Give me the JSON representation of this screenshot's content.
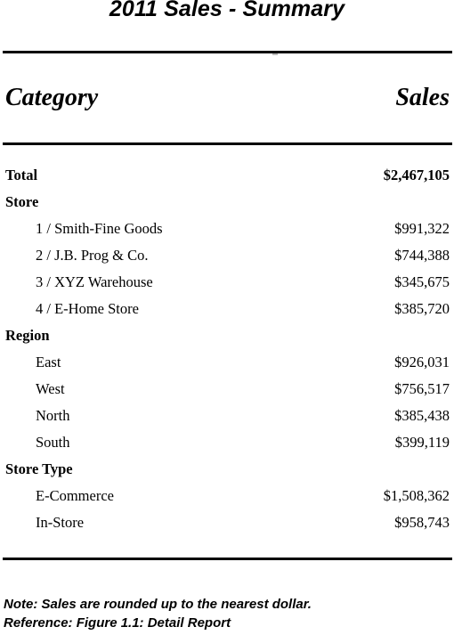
{
  "report": {
    "title": "2011 Sales - Summary"
  },
  "columns": {
    "category_label": "Category",
    "sales_label": "Sales"
  },
  "total": {
    "label": "Total",
    "value": "$2,467,105"
  },
  "groups": [
    {
      "name": "Store",
      "rows": [
        {
          "label": "1 / Smith-Fine Goods",
          "value": "$991,322"
        },
        {
          "label": "2 / J.B. Prog & Co.",
          "value": "$744,388"
        },
        {
          "label": "3 / XYZ Warehouse",
          "value": "$345,675"
        },
        {
          "label": "4 / E-Home Store",
          "value": "$385,720"
        }
      ]
    },
    {
      "name": "Region",
      "rows": [
        {
          "label": "East",
          "value": "$926,031"
        },
        {
          "label": "West",
          "value": "$756,517"
        },
        {
          "label": "North",
          "value": "$385,438"
        },
        {
          "label": "South",
          "value": "$399,119"
        }
      ]
    },
    {
      "name": "Store Type",
      "rows": [
        {
          "label": "E-Commerce",
          "value": "$1,508,362"
        },
        {
          "label": "In-Store",
          "value": "$958,743"
        }
      ]
    }
  ],
  "footer": {
    "note": "Note: Sales are rounded up to the nearest dollar.",
    "reference": "Reference: Figure 1.1: Detail Report"
  },
  "chart_data": {
    "type": "table",
    "title": "2011 Sales - Summary",
    "columns": [
      "Category",
      "Sales"
    ],
    "rows": [
      {
        "category": "Total",
        "sales": 2467105,
        "level": "total"
      },
      {
        "category": "Store",
        "sales": null,
        "level": "group"
      },
      {
        "category": "1 / Smith-Fine Goods",
        "sales": 991322,
        "level": "detail"
      },
      {
        "category": "2 / J.B. Prog & Co.",
        "sales": 744388,
        "level": "detail"
      },
      {
        "category": "3 / XYZ Warehouse",
        "sales": 345675,
        "level": "detail"
      },
      {
        "category": "4 / E-Home Store",
        "sales": 385720,
        "level": "detail"
      },
      {
        "category": "Region",
        "sales": null,
        "level": "group"
      },
      {
        "category": "East",
        "sales": 926031,
        "level": "detail"
      },
      {
        "category": "West",
        "sales": 756517,
        "level": "detail"
      },
      {
        "category": "North",
        "sales": 385438,
        "level": "detail"
      },
      {
        "category": "South",
        "sales": 399119,
        "level": "detail"
      },
      {
        "category": "Store Type",
        "sales": null,
        "level": "group"
      },
      {
        "category": "E-Commerce",
        "sales": 1508362,
        "level": "detail"
      },
      {
        "category": "In-Store",
        "sales": 958743,
        "level": "detail"
      }
    ]
  }
}
